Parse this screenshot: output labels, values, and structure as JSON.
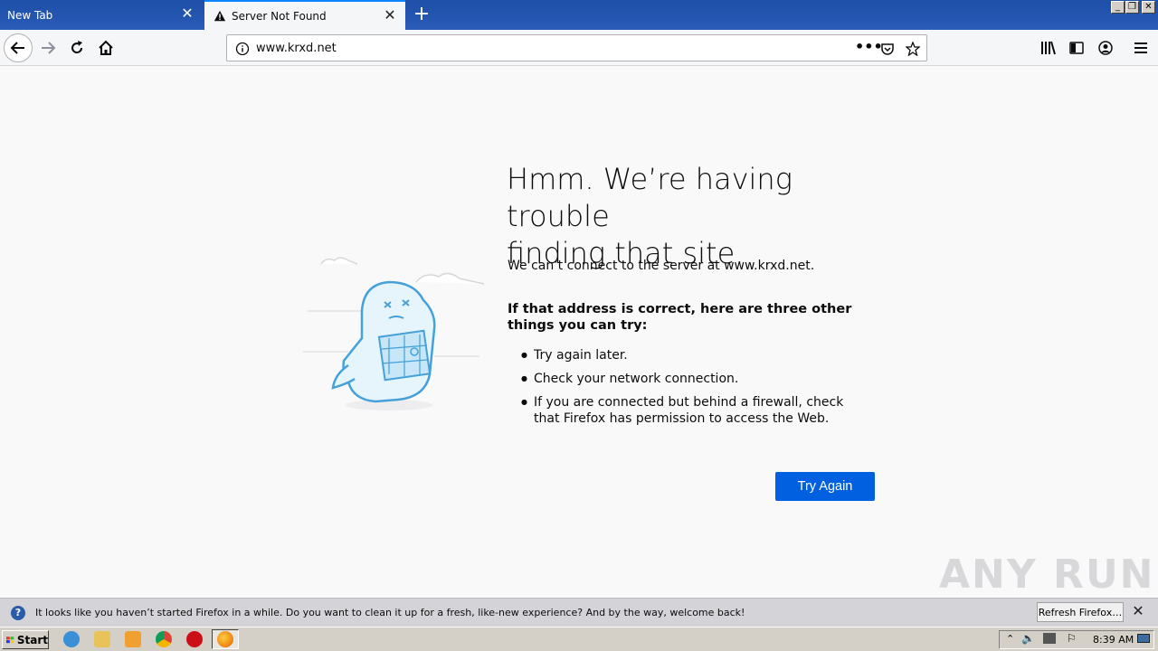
{
  "browser": {
    "tabs": [
      {
        "label": "New Tab",
        "active": false
      },
      {
        "label": "Server Not Found",
        "active": true
      }
    ],
    "url": "www.krxd.net"
  },
  "error_page": {
    "title_line1": "Hmm. We’re having trouble",
    "title_line2": "finding that site.",
    "description": "We can’t connect to the server at www.krxd.net.",
    "subheading": "If that address is correct, here are three other things you can try:",
    "suggestions": [
      "Try again later.",
      "Check your network connection.",
      "If you are connected but behind a firewall, check that Firefox has permission to access the Web."
    ],
    "try_again_label": "Try Again"
  },
  "notification": {
    "message": "It looks like you haven’t started Firefox in a while. Do you want to clean it up for a fresh, like-new experience? And by the way, welcome back!",
    "button_label": "Refresh Firefox…"
  },
  "taskbar": {
    "start_label": "Start",
    "clock": "8:39 AM"
  },
  "watermark": "ANY RUN",
  "colors": {
    "accent": "#0060df",
    "tabbar": "#1d4fa8",
    "illustration": "#45a1d9"
  }
}
